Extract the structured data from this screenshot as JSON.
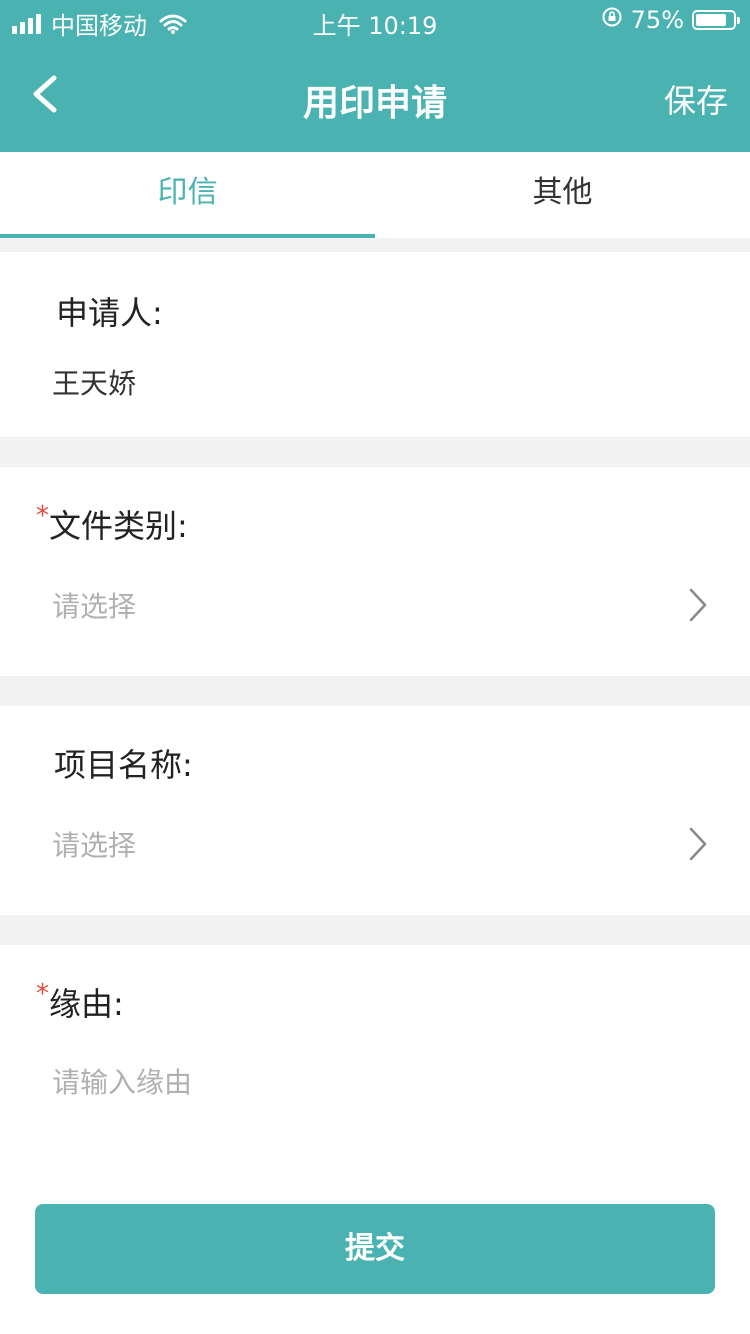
{
  "status_bar": {
    "carrier": "中国移动",
    "time": "上午 10:19",
    "battery": "75%",
    "icons": [
      "signal-icon",
      "wifi-icon",
      "rotation-lock-icon",
      "battery-icon"
    ]
  },
  "navbar": {
    "title": "用印申请",
    "save_label": "保存",
    "back_icon": "chevron-left-icon"
  },
  "tabs": [
    {
      "label": "印信",
      "active": true
    },
    {
      "label": "其他",
      "active": false
    }
  ],
  "form": {
    "applicant": {
      "label": "申请人:",
      "value": "王天娇"
    },
    "file_type": {
      "required_mark": "*",
      "label": "文件类别:",
      "placeholder": "请选择"
    },
    "project_name": {
      "label": "项目名称:",
      "placeholder": "请选择"
    },
    "reason": {
      "required_mark": "*",
      "label": "缘由:",
      "placeholder": "请输入缘由"
    }
  },
  "submit_label": "提交",
  "colors": {
    "accent": "#4ab3b2",
    "required": "#e0493b",
    "placeholder": "#b0b0b0",
    "divider": "#f2f2f2"
  }
}
